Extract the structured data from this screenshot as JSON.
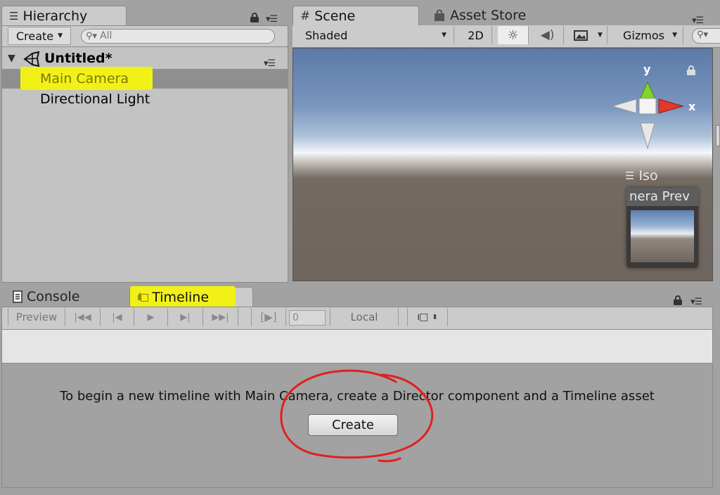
{
  "hierarchy": {
    "tab_label": "Hierarchy",
    "create_label": "Create",
    "search_placeholder": "All",
    "scene_name": "Untitled*",
    "items": [
      {
        "label": "Main Camera",
        "selected": true
      },
      {
        "label": "Directional Light",
        "selected": false
      }
    ]
  },
  "scene": {
    "tab_label": "Scene",
    "asset_store_label": "Asset Store",
    "shading_mode": "Shaded",
    "mode_2d_label": "2D",
    "gizmos_label": "Gizmos",
    "gizmo_axes": {
      "y": "y",
      "x": "x"
    },
    "projection_label": "Iso",
    "camera_preview_label": "nera Prev"
  },
  "bottom": {
    "console_tab_label": "Console",
    "timeline_tab_label": "Timeline",
    "preview_label": "Preview",
    "frame_value": "0",
    "local_label": "Local",
    "message": "To begin a new timeline with Main Camera, create a Director component and a Timeline asset",
    "create_button_label": "Create"
  },
  "colors": {
    "highlight": "#f1f117",
    "selection": "#8f8f8f",
    "annotation": "#e0201f",
    "gizmo_x": "#e23a2a",
    "gizmo_y": "#7ed62a"
  }
}
